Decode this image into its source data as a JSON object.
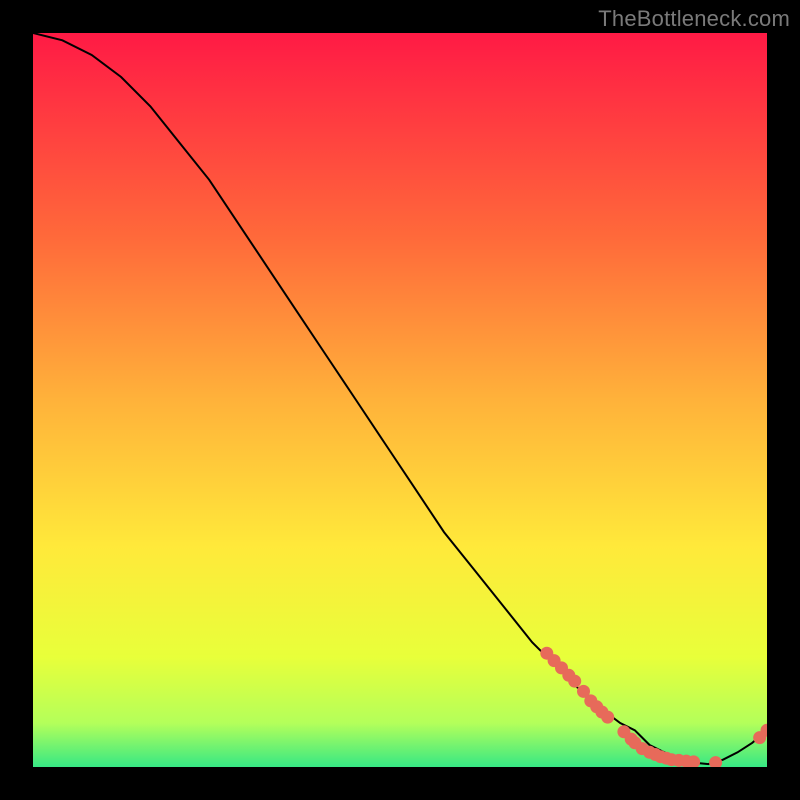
{
  "watermark": "TheBottleneck.com",
  "colors": {
    "top": "#ff1a45",
    "mid1": "#ff6a3a",
    "mid2": "#ffb23a",
    "mid3": "#ffe93a",
    "mid4": "#e8ff3a",
    "mid5": "#b4ff5a",
    "bottom": "#37e884",
    "curve": "#000000",
    "marker": "#e76a5a"
  },
  "chart_data": {
    "type": "line",
    "title": "",
    "xlabel": "",
    "ylabel": "",
    "xlim": [
      0,
      100
    ],
    "ylim": [
      0,
      100
    ],
    "grid": false,
    "legend": false,
    "series": [
      {
        "name": "bottleneck-curve",
        "x": [
          0,
          4,
          8,
          12,
          16,
          20,
          24,
          28,
          32,
          36,
          40,
          44,
          48,
          52,
          56,
          60,
          64,
          68,
          72,
          76,
          80,
          82,
          84,
          86,
          88,
          90,
          92,
          94,
          96,
          98,
          100
        ],
        "values": [
          100,
          99,
          97,
          94,
          90,
          85,
          80,
          74,
          68,
          62,
          56,
          50,
          44,
          38,
          32,
          27,
          22,
          17,
          13,
          9,
          6,
          5,
          3,
          2,
          1,
          0.6,
          0.4,
          1.0,
          2.0,
          3.3,
          5
        ]
      }
    ],
    "markers": [
      {
        "x": 70.0,
        "y": 15.5
      },
      {
        "x": 71.0,
        "y": 14.5
      },
      {
        "x": 72.0,
        "y": 13.5
      },
      {
        "x": 73.0,
        "y": 12.5
      },
      {
        "x": 73.8,
        "y": 11.7
      },
      {
        "x": 75.0,
        "y": 10.3
      },
      {
        "x": 76.0,
        "y": 9.0
      },
      {
        "x": 76.8,
        "y": 8.2
      },
      {
        "x": 77.5,
        "y": 7.5
      },
      {
        "x": 78.3,
        "y": 6.8
      },
      {
        "x": 80.5,
        "y": 4.8
      },
      {
        "x": 81.5,
        "y": 3.8
      },
      {
        "x": 82.0,
        "y": 3.3
      },
      {
        "x": 83.0,
        "y": 2.5
      },
      {
        "x": 84.0,
        "y": 2.0
      },
      {
        "x": 84.8,
        "y": 1.7
      },
      {
        "x": 85.5,
        "y": 1.4
      },
      {
        "x": 86.3,
        "y": 1.2
      },
      {
        "x": 87.0,
        "y": 1.0
      },
      {
        "x": 88.0,
        "y": 0.9
      },
      {
        "x": 89.0,
        "y": 0.8
      },
      {
        "x": 90.0,
        "y": 0.7
      },
      {
        "x": 93.0,
        "y": 0.6
      },
      {
        "x": 99.0,
        "y": 4.0
      },
      {
        "x": 100.0,
        "y": 5.0
      }
    ]
  }
}
